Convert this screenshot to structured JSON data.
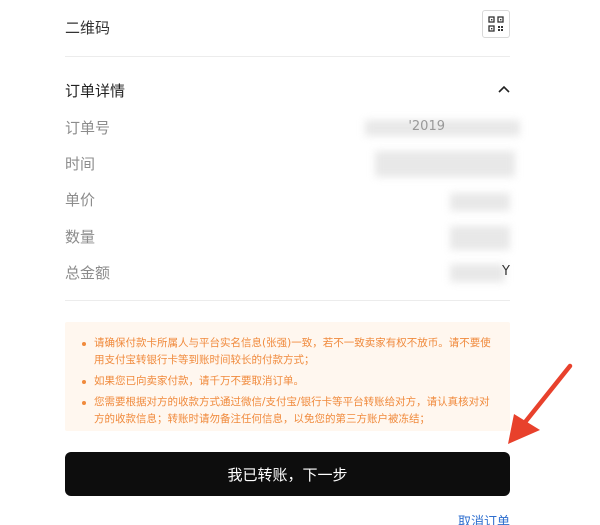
{
  "qrcode": {
    "label": "二维码",
    "icon": "qrcode-icon"
  },
  "order": {
    "title": "订单详情",
    "toggle_icon": "chevron-up-icon",
    "fields": [
      {
        "label": "订单号",
        "value": "'2019"
      },
      {
        "label": "时间",
        "value": ""
      },
      {
        "label": "单价",
        "value": ""
      },
      {
        "label": "数量",
        "value": ""
      },
      {
        "label": "总金额",
        "value": "Y"
      }
    ]
  },
  "notice": {
    "items": [
      "请确保付款卡所属人与平台实名信息(张强)一致，若不一致卖家有权不放币。请不要使用支付宝转银行卡等到账时间较长的付款方式；",
      "如果您已向卖家付款，请千万不要取消订单。",
      "您需要根据对方的收款方式通过微信/支付宝/银行卡等平台转账给对方，请认真核对对方的收款信息；转账时请勿备注任何信息，以免您的第三方账户被冻结；"
    ],
    "color": "#f08a3c",
    "background": "#fff7ef"
  },
  "actions": {
    "primary_label": "我已转账，下一步",
    "cancel_label": "取消订单"
  },
  "colors": {
    "accent_link": "#2f6fcf",
    "button_bg": "#0d0d0d",
    "arrow": "#e8412c"
  }
}
